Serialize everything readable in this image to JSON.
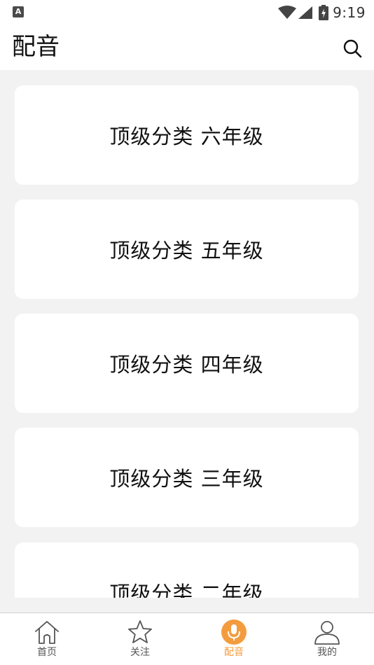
{
  "status_bar": {
    "app_icon_letter": "A",
    "time": "9:19"
  },
  "header": {
    "title": "配音"
  },
  "categories": [
    {
      "label": "顶级分类 六年级"
    },
    {
      "label": "顶级分类 五年级"
    },
    {
      "label": "顶级分类 四年级"
    },
    {
      "label": "顶级分类 三年级"
    },
    {
      "label": "顶级分类 二年级"
    }
  ],
  "bottom_nav": {
    "items": [
      {
        "label": "首页",
        "icon": "home-icon"
      },
      {
        "label": "关注",
        "icon": "star-icon"
      },
      {
        "label": "配音",
        "icon": "microphone-icon",
        "active": true
      },
      {
        "label": "我的",
        "icon": "person-icon"
      }
    ]
  },
  "colors": {
    "accent": "#f39c3d",
    "background": "#f2f2f2",
    "card": "#ffffff"
  }
}
